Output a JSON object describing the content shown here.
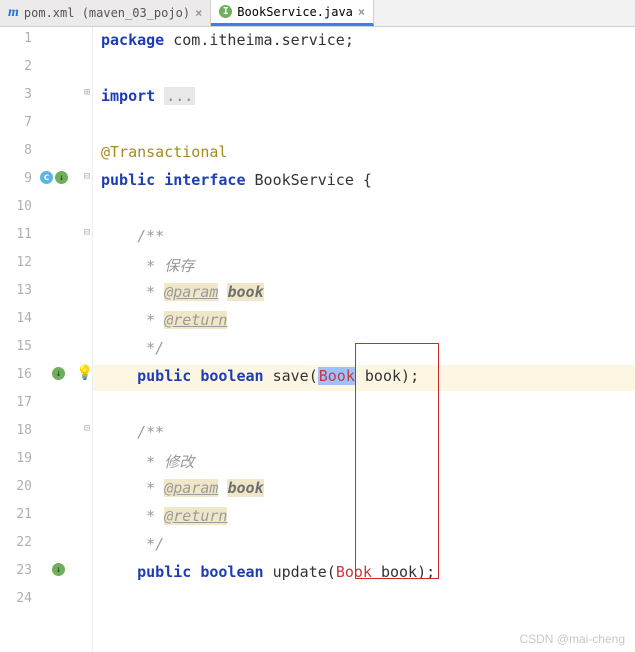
{
  "tabs": [
    {
      "label": "pom.xml (maven_03_pojo)",
      "active": false,
      "icon": "m"
    },
    {
      "label": "BookService.java",
      "active": true,
      "icon": "i"
    }
  ],
  "lines": {
    "l1": "1",
    "l2": "2",
    "l3": "3",
    "l7": "7",
    "l8": "8",
    "l9": "9",
    "l10": "10",
    "l11": "11",
    "l12": "12",
    "l13": "13",
    "l14": "14",
    "l15": "15",
    "l16": "16",
    "l17": "17",
    "l18": "18",
    "l19": "19",
    "l20": "20",
    "l21": "21",
    "l22": "22",
    "l23": "23",
    "l24": "24"
  },
  "code": {
    "kw_package": "package",
    "pkg": "com.itheima.service",
    "semi": ";",
    "kw_import": "import",
    "ellipsis": "...",
    "ann": "@Transactional",
    "kw_public": "public",
    "kw_interface": "interface",
    "cls": "BookService",
    "brace_open": "{",
    "jd_open": "/**",
    "jd_star": " * ",
    "jd_close": " */",
    "jd_save": "保存",
    "jd_update": "修改",
    "jd_param": "@param",
    "jd_param_name": "book",
    "jd_return": "@return",
    "kw_boolean": "boolean",
    "m_save": "save",
    "m_update": "update",
    "type_book": "Book",
    "p_book": "book",
    "paren_open": "(",
    "paren_close": ")",
    "sp": " "
  },
  "watermark": "CSDN @mai-cheng",
  "close_glyph": "×"
}
